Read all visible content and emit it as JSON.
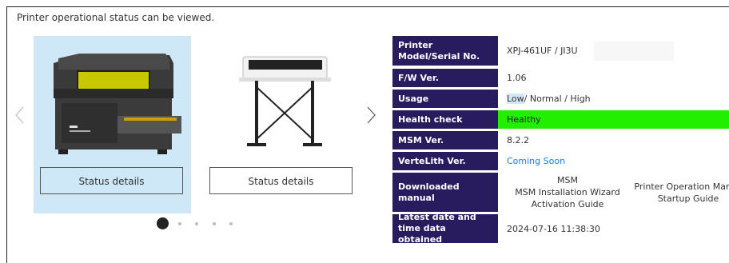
{
  "intro": "Printer operational status can be viewed.",
  "cards": [
    {
      "button_label": "Status details",
      "selected": true
    },
    {
      "button_label": "Status details",
      "selected": false
    }
  ],
  "pagination": {
    "count": 5,
    "active": 1
  },
  "info": {
    "model_label": "Printer Model/Serial No.",
    "model_value": "XPJ-461UF / JI3U",
    "fw_label": "F/W Ver.",
    "fw_value": "1.06",
    "usage_label": "Usage",
    "usage_low": "Low",
    "usage_rest": " / Normal / High",
    "health_label": "Health check",
    "health_value": "Healthy",
    "health_color": "#22ee00",
    "msm_label": "MSM Ver.",
    "msm_value": "8.2.2",
    "vertelith_label": "VerteLith Ver.",
    "vertelith_value": "Coming Soon",
    "manual_label": "Downloaded manual",
    "manual_col1": [
      "MSM",
      "MSM Installation Wizard",
      "Activation Guide"
    ],
    "manual_col2": [
      "Printer Operation Manua",
      "Startup Guide"
    ],
    "date_label": "Latest date and time data obtained",
    "date_value": "2024-07-16 11:38:30"
  },
  "colors": {
    "header_bg": "#281c5e",
    "selected_card": "#cfe8f8",
    "link": "#1a7dd6"
  }
}
